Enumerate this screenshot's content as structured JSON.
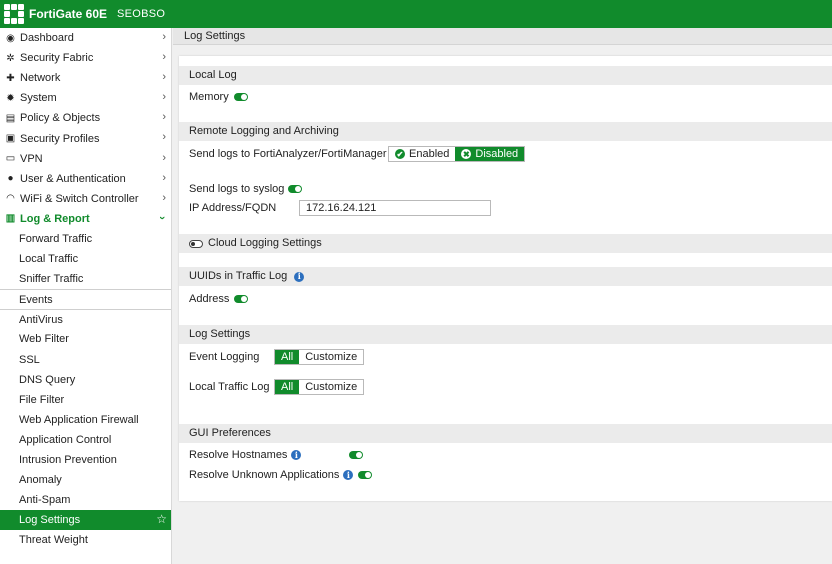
{
  "topbar": {
    "product": "FortiGate 60E",
    "hostname": "SEOBSO",
    "brand_color": "#118b2c"
  },
  "sidebar": {
    "items": [
      {
        "label": "Dashboard",
        "icon": "dashboard-icon"
      },
      {
        "label": "Security Fabric",
        "icon": "security-fabric-icon"
      },
      {
        "label": "Network",
        "icon": "network-icon"
      },
      {
        "label": "System",
        "icon": "gear-icon"
      },
      {
        "label": "Policy & Objects",
        "icon": "policy-icon"
      },
      {
        "label": "Security Profiles",
        "icon": "lock-icon"
      },
      {
        "label": "VPN",
        "icon": "monitor-icon"
      },
      {
        "label": "User & Authentication",
        "icon": "user-icon"
      },
      {
        "label": "WiFi & Switch Controller",
        "icon": "wifi-icon"
      },
      {
        "label": "Log & Report",
        "icon": "chart-icon"
      }
    ],
    "log_report_sub": [
      "Forward Traffic",
      "Local Traffic",
      "Sniffer Traffic",
      "Events",
      "AntiVirus",
      "Web Filter",
      "SSL",
      "DNS Query",
      "File Filter",
      "Web Application Firewall",
      "Application Control",
      "Intrusion Prevention",
      "Anomaly",
      "Anti-Spam",
      "Log Settings",
      "Threat Weight"
    ]
  },
  "page": {
    "title": "Log Settings"
  },
  "local_log": {
    "heading": "Local Log",
    "memory_label": "Memory",
    "memory_enabled": true
  },
  "remote": {
    "heading": "Remote Logging and Archiving",
    "send_fortianalyzer_label": "Send logs to FortiAnalyzer/FortiManager",
    "enabled_label": "Enabled",
    "disabled_label": "Disabled",
    "selected": "Disabled",
    "syslog_label": "Send logs to syslog",
    "syslog_enabled": true,
    "ip_label": "IP Address/FQDN",
    "ip_value": "172.16.24.121"
  },
  "cloud": {
    "label": "Cloud Logging Settings",
    "enabled": false
  },
  "uuids": {
    "heading": "UUIDs in Traffic Log",
    "address_label": "Address",
    "address_enabled": true
  },
  "log_settings": {
    "heading": "Log Settings",
    "event_logging_label": "Event Logging",
    "local_traffic_label": "Local Traffic Log",
    "all_label": "All",
    "customize_label": "Customize",
    "selected": "All"
  },
  "gui": {
    "heading": "GUI Preferences",
    "resolve_hostnames_label": "Resolve Hostnames",
    "resolve_hostnames_enabled": true,
    "resolve_apps_label": "Resolve Unknown Applications",
    "resolve_apps_enabled": true
  }
}
